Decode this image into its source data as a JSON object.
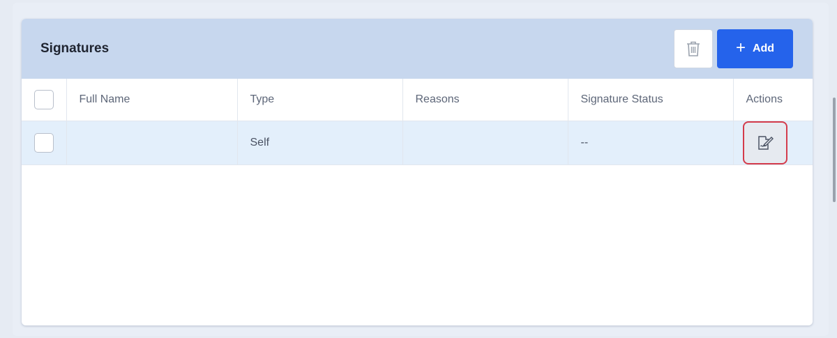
{
  "panel": {
    "title": "Signatures",
    "delete_icon": "trash-icon",
    "add_label": "Add",
    "add_icon": "plus-icon",
    "colors": {
      "header_bg": "#c7d7ee",
      "add_bg": "#2563eb",
      "row_highlight": "#e3effb",
      "action_border": "#d43b4b"
    }
  },
  "table": {
    "columns": [
      "Full Name",
      "Type",
      "Reasons",
      "Signature Status",
      "Actions"
    ],
    "rows": [
      {
        "full_name": "",
        "type": "Self",
        "reasons": "",
        "status": "--",
        "action_icon": "sign-document-icon"
      }
    ]
  }
}
